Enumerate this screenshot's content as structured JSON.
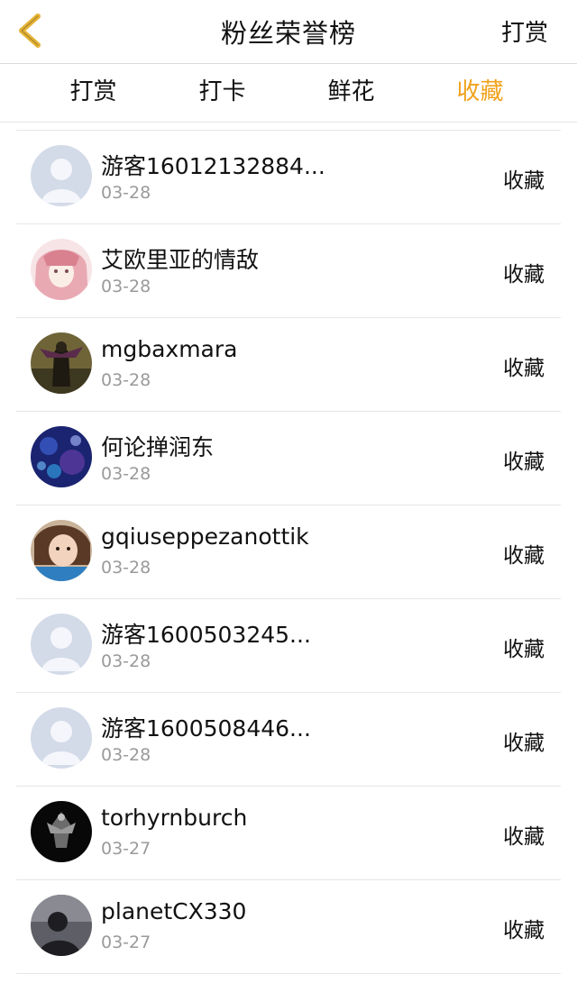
{
  "header": {
    "title": "粉丝荣誉榜",
    "action_label": "打赏"
  },
  "tabs": [
    {
      "label": "打赏",
      "active": false
    },
    {
      "label": "打卡",
      "active": false
    },
    {
      "label": "鲜花",
      "active": false
    },
    {
      "label": "收藏",
      "active": true
    }
  ],
  "colors": {
    "accent": "#f0a21c",
    "back_icon": "#e6b437"
  },
  "list": [
    {
      "name": "游客16012132884...",
      "date": "03-28",
      "action": "收藏",
      "avatar": "default-avatar"
    },
    {
      "name": "艾欧里亚的情敌",
      "date": "03-28",
      "action": "收藏",
      "avatar": "anime-girl-avatar"
    },
    {
      "name": "mgbaxmara",
      "date": "03-28",
      "action": "收藏",
      "avatar": "dark-figure-avatar"
    },
    {
      "name": "何论掸润东",
      "date": "03-28",
      "action": "收藏",
      "avatar": "blue-pattern-avatar"
    },
    {
      "name": "gqiuseppezanottik",
      "date": "03-28",
      "action": "收藏",
      "avatar": "girl-photo-avatar"
    },
    {
      "name": "游客1600503245...",
      "date": "03-28",
      "action": "收藏",
      "avatar": "default-avatar"
    },
    {
      "name": "游客1600508446...",
      "date": "03-28",
      "action": "收藏",
      "avatar": "default-avatar"
    },
    {
      "name": "torhyrnburch",
      "date": "03-27",
      "action": "收藏",
      "avatar": "black-emblem-avatar"
    },
    {
      "name": "planetCX330",
      "date": "03-27",
      "action": "收藏",
      "avatar": "silhouette-avatar"
    }
  ]
}
